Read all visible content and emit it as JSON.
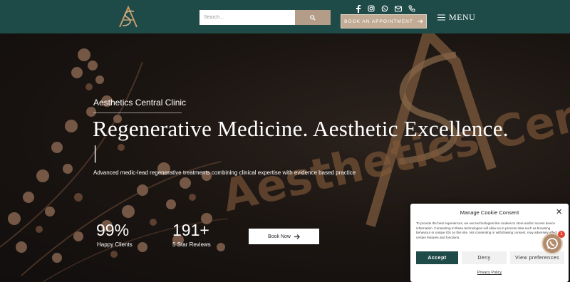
{
  "header": {
    "logo_name": "monogram-logo",
    "search": {
      "placeholder": "Search...",
      "value": ""
    },
    "book_appointment_label": "BOOK AN APPOINTMENT",
    "menu_label": "MENU",
    "social_icons": [
      "facebook-icon",
      "instagram-icon",
      "whatsapp-icon",
      "email-icon",
      "phone-icon"
    ]
  },
  "hero": {
    "eyebrow": "Aesthetics Central Clinic",
    "headline": "Regenerative Medicine. Aesthetic Excellence.",
    "cursor": "|",
    "subtitle": "Advanced medic-lead regenerative treatments combining clinical expertise with evidence based practice",
    "background_sign_text": "Aesthetics Central Ltd",
    "stats": [
      {
        "value": "99%",
        "label": "Happy Clients"
      },
      {
        "value": "191+",
        "label": "5 Star Reviews"
      }
    ],
    "book_now_label": "Book Now"
  },
  "cookie": {
    "title": "Manage Cookie Consent",
    "body": "To provide the best experiences, we use technologies like cookies to store and/or access device information. Consenting to these technologies will allow us to process data such as browsing behaviour or unique IDs on this site. Not consenting or withdrawing consent, may adversely affect certain features and functions.",
    "accept_label": "Accept",
    "deny_label": "Deny",
    "preferences_label": "View preferences",
    "privacy_label": "Privacy Policy"
  },
  "whatsapp_badge": "1",
  "colors": {
    "header": "#1e4a48",
    "accent": "#c2ab95",
    "gold": "#c79a6a"
  }
}
